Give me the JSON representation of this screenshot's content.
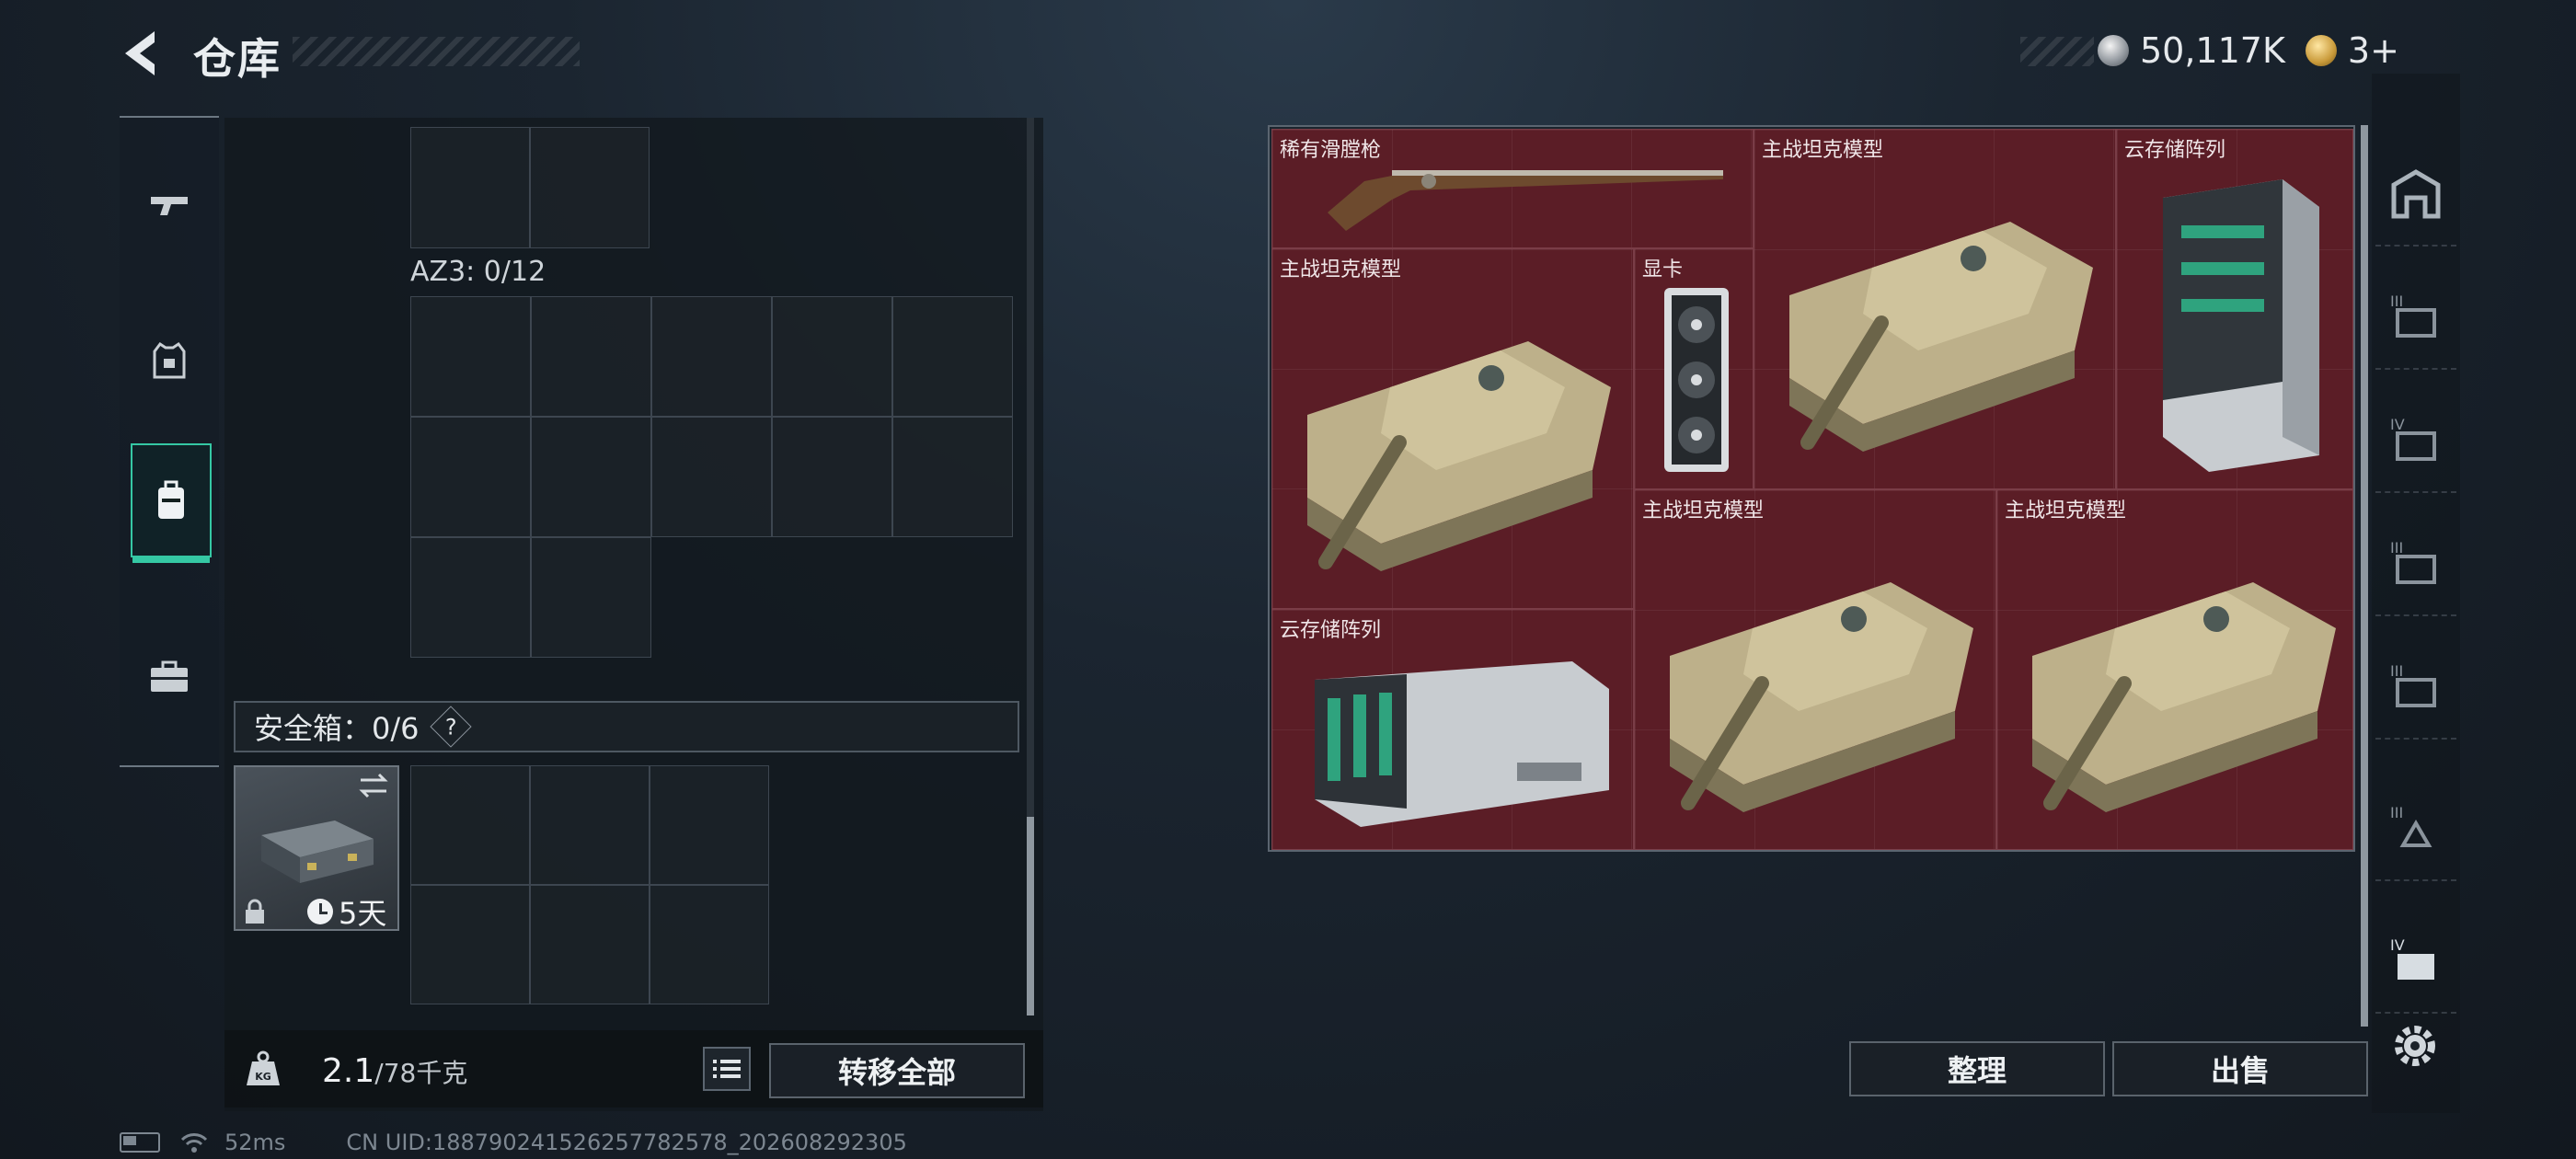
{
  "header": {
    "title": "仓库"
  },
  "currency": {
    "silver": "50,117K",
    "gold": "3+"
  },
  "left_rail": {
    "tabs": [
      "weapons",
      "armor",
      "backpack",
      "toolbox"
    ],
    "active": "backpack"
  },
  "container": {
    "az3_label": "AZ3: 0/12"
  },
  "safe_box": {
    "label": "安全箱：0/6",
    "help": "?",
    "timer": "5天"
  },
  "weight": {
    "current": "2.1",
    "capacity": "/78千克"
  },
  "buttons": {
    "transfer_all": "转移全部",
    "sort": "整理",
    "sell": "出售"
  },
  "status_bar": {
    "ping": "52ms",
    "uid": "CN UID:188790241526257782578_202608292305"
  },
  "stash_items": [
    {
      "label": "稀有滑膛枪",
      "icon": "musket-icon"
    },
    {
      "label": "主战坦克模型",
      "icon": "tank-icon"
    },
    {
      "label": "云存储阵列",
      "icon": "storage-array-icon"
    },
    {
      "label": "主战坦克模型",
      "icon": "tank-icon"
    },
    {
      "label": "显卡",
      "icon": "graphics-card-icon"
    },
    {
      "label": "云存储阵列",
      "icon": "storage-array-icon"
    },
    {
      "label": "主战坦克模型",
      "icon": "tank-icon"
    },
    {
      "label": "主战坦克模型",
      "icon": "tank-icon"
    }
  ],
  "right_rail": {
    "tabs": [
      "home-icon",
      "container-iii-icon",
      "container-iv-icon",
      "container-iii-icon",
      "container-iii-icon",
      "container-iii-icon",
      "container-iv-icon"
    ]
  },
  "colors": {
    "accent": "#35c8a4",
    "item_bg": "#5b1d26"
  }
}
